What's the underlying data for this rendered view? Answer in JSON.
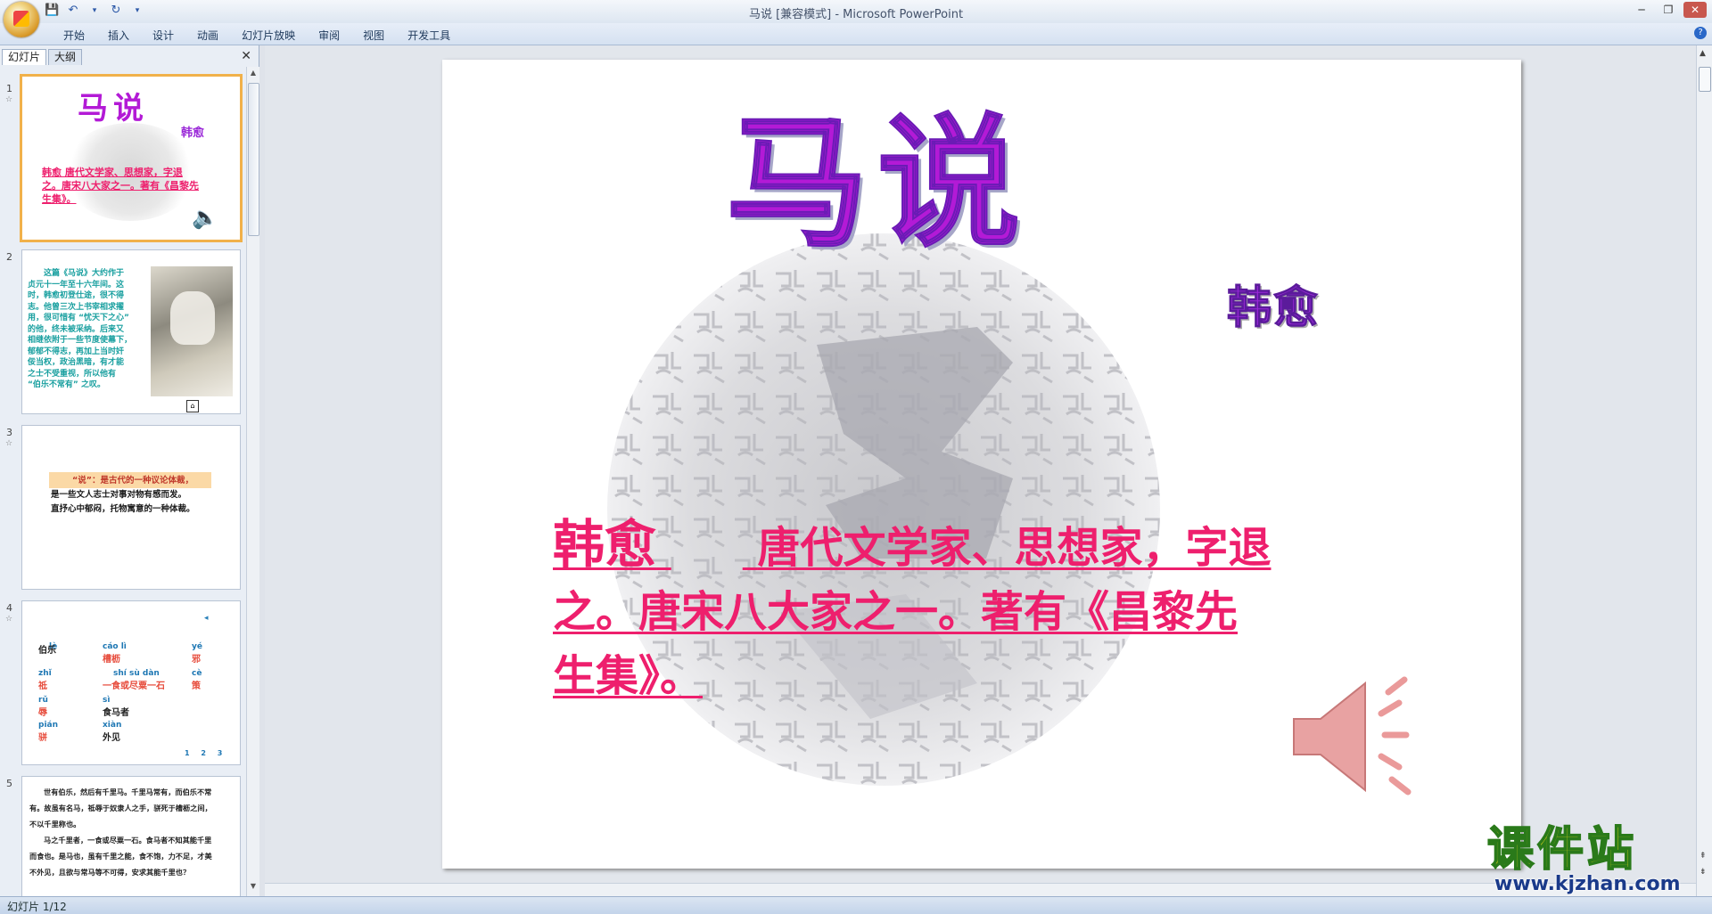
{
  "window": {
    "title": "马说 [兼容模式] - Microsoft PowerPoint"
  },
  "ribbon": {
    "tabs": [
      "开始",
      "插入",
      "设计",
      "动画",
      "幻灯片放映",
      "审阅",
      "视图",
      "开发工具"
    ]
  },
  "panel": {
    "tab_slides": "幻灯片",
    "tab_outline": "大纲",
    "close": "✕"
  },
  "thumbnails": [
    {
      "num": "1",
      "title": "马说",
      "author": "韩愈",
      "line1": "韩愈  唐代文学家、思想家，字退",
      "line2": "之。唐宋八大家之一。著有《昌黎先",
      "line3": "生集》。"
    },
    {
      "num": "2",
      "lines": [
        "这篇《马说》大约作于",
        "贞元十一年至十六年间。这",
        "时，韩愈初登仕途，很不得",
        "志。他曾三次上书宰相求擢",
        "用，很可惜有 “忧天下之心”",
        "的他，终未被采纳。后来又",
        "相继依附于一些节度使幕下，",
        "郁郁不得志，再加上当时奸",
        "佞当权，政治黑暗，有才能",
        "之士不受重视，所以他有",
        "“伯乐不常有” 之叹。"
      ]
    },
    {
      "num": "3",
      "line1": "“说”：是古代的一种议论体裁，",
      "line2": "是一些文人志士对事对物有感而发。",
      "line3": "直抒心中郁闷，托物寓意的一种体裁。"
    },
    {
      "num": "4",
      "items": [
        {
          "py": "lè",
          "word": "伯乐"
        },
        {
          "py": "cáo lì",
          "word": "槽枥"
        },
        {
          "py": "yé",
          "word": "邪"
        },
        {
          "py": "zhǐ",
          "word": "祗"
        },
        {
          "py": "shí sù dàn",
          "word": "一食或尽粟一石"
        },
        {
          "py": "cè",
          "word": "策"
        },
        {
          "py": "rǔ",
          "word": "辱"
        },
        {
          "py": "sì",
          "word": "食马者"
        },
        {
          "py": "pián",
          "word": "骈"
        },
        {
          "py": "xiàn",
          "word": "外见"
        }
      ],
      "pages": [
        "1",
        "2",
        "3"
      ]
    },
    {
      "num": "5",
      "lines": [
        "世有伯乐，然后有千里马。千里马常有，而伯乐不常",
        "有。故虽有名马，祗辱于奴隶人之手，骈死于槽枥之间，",
        "不以千里称也。",
        "马之千里者，一食或尽粟一石。食马者不知其能千里",
        "而食也。是马也，虽有千里之能，食不饱，力不足，才美",
        "不外见，且欲与常马等不可得，安求其能千里也？"
      ]
    }
  ],
  "slide": {
    "title": "马说",
    "author": "韩愈",
    "name": "韩愈",
    "text_line1": "唐代文学家、思想家，字退",
    "text_line2": "之。唐宋八大家之一。著有《昌黎先",
    "text_line3": "生集》。"
  },
  "status": {
    "slide_count": "幻灯片 1/12"
  },
  "watermark": {
    "text": "课件站",
    "url": "www.kjzhan.com"
  },
  "colors": {
    "accent_pink": "#ee1f6d",
    "title_purple": "#b31ad6",
    "selection_orange": "#f1b14a"
  },
  "icons": [
    "office-button-icon",
    "save-icon",
    "undo-icon",
    "redo-icon",
    "speaker-icon",
    "help-icon"
  ]
}
